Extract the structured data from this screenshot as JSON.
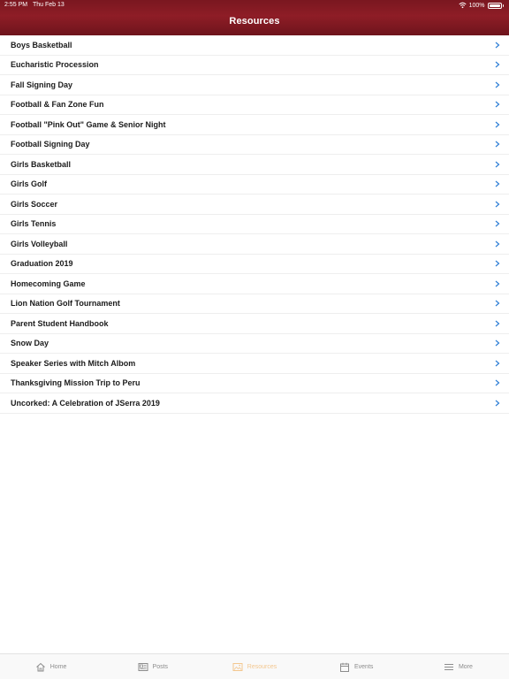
{
  "status_bar": {
    "time": "2:55 PM",
    "date": "Thu Feb 13",
    "battery": "100%"
  },
  "header": {
    "title": "Resources"
  },
  "list_items": [
    "Boys Basketball",
    "Eucharistic Procession",
    "Fall Signing Day",
    "Football & Fan Zone Fun",
    "Football \"Pink Out\" Game & Senior Night",
    "Football Signing Day",
    "Girls Basketball",
    "Girls Golf",
    "Girls Soccer",
    "Girls Tennis",
    "Girls Volleyball",
    "Graduation 2019",
    "Homecoming Game",
    "Lion Nation Golf Tournament",
    "Parent Student Handbook",
    "Snow Day",
    "Speaker Series with Mitch Albom",
    "Thanksgiving Mission Trip to Peru",
    "Uncorked: A Celebration of JSerra 2019"
  ],
  "tabs": [
    {
      "label": "Home",
      "icon": "home-icon"
    },
    {
      "label": "Posts",
      "icon": "posts-icon"
    },
    {
      "label": "Resources",
      "icon": "resources-icon",
      "active": true
    },
    {
      "label": "Events",
      "icon": "calendar-icon"
    },
    {
      "label": "More",
      "icon": "menu-icon"
    }
  ],
  "colors": {
    "header": "#7a1720",
    "chevron": "#2f7fd6",
    "active_tab": "#f3c78f",
    "inactive_tab": "#8c8c8c"
  }
}
